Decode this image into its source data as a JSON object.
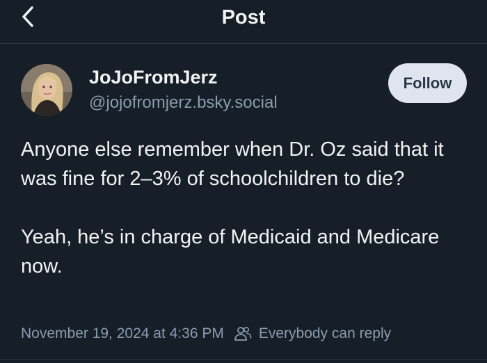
{
  "header": {
    "title": "Post"
  },
  "author": {
    "display_name": "JoJoFromJerz",
    "handle": "@jojofromjerz.bsky.social"
  },
  "follow_button": {
    "label": "Follow"
  },
  "post": {
    "paragraph_1": "Anyone else remember when Dr. Oz said that it was fine for 2–3% of schoolchildren to die?",
    "paragraph_2": "Yeah, he’s in charge of Medicaid and Medicare now."
  },
  "meta": {
    "timestamp": "November 19, 2024 at 4:36 PM",
    "reply_setting": "Everybody can reply"
  },
  "icons": {
    "back": "chevron-left-icon",
    "reply_setting": "people-icon"
  },
  "colors": {
    "background": "#161e27",
    "text": "#f1f3f5",
    "muted_text": "#8c9cad",
    "follow_button_bg": "#dfe5ee",
    "follow_button_text": "#2a3645",
    "divider": "#2e3a48"
  }
}
